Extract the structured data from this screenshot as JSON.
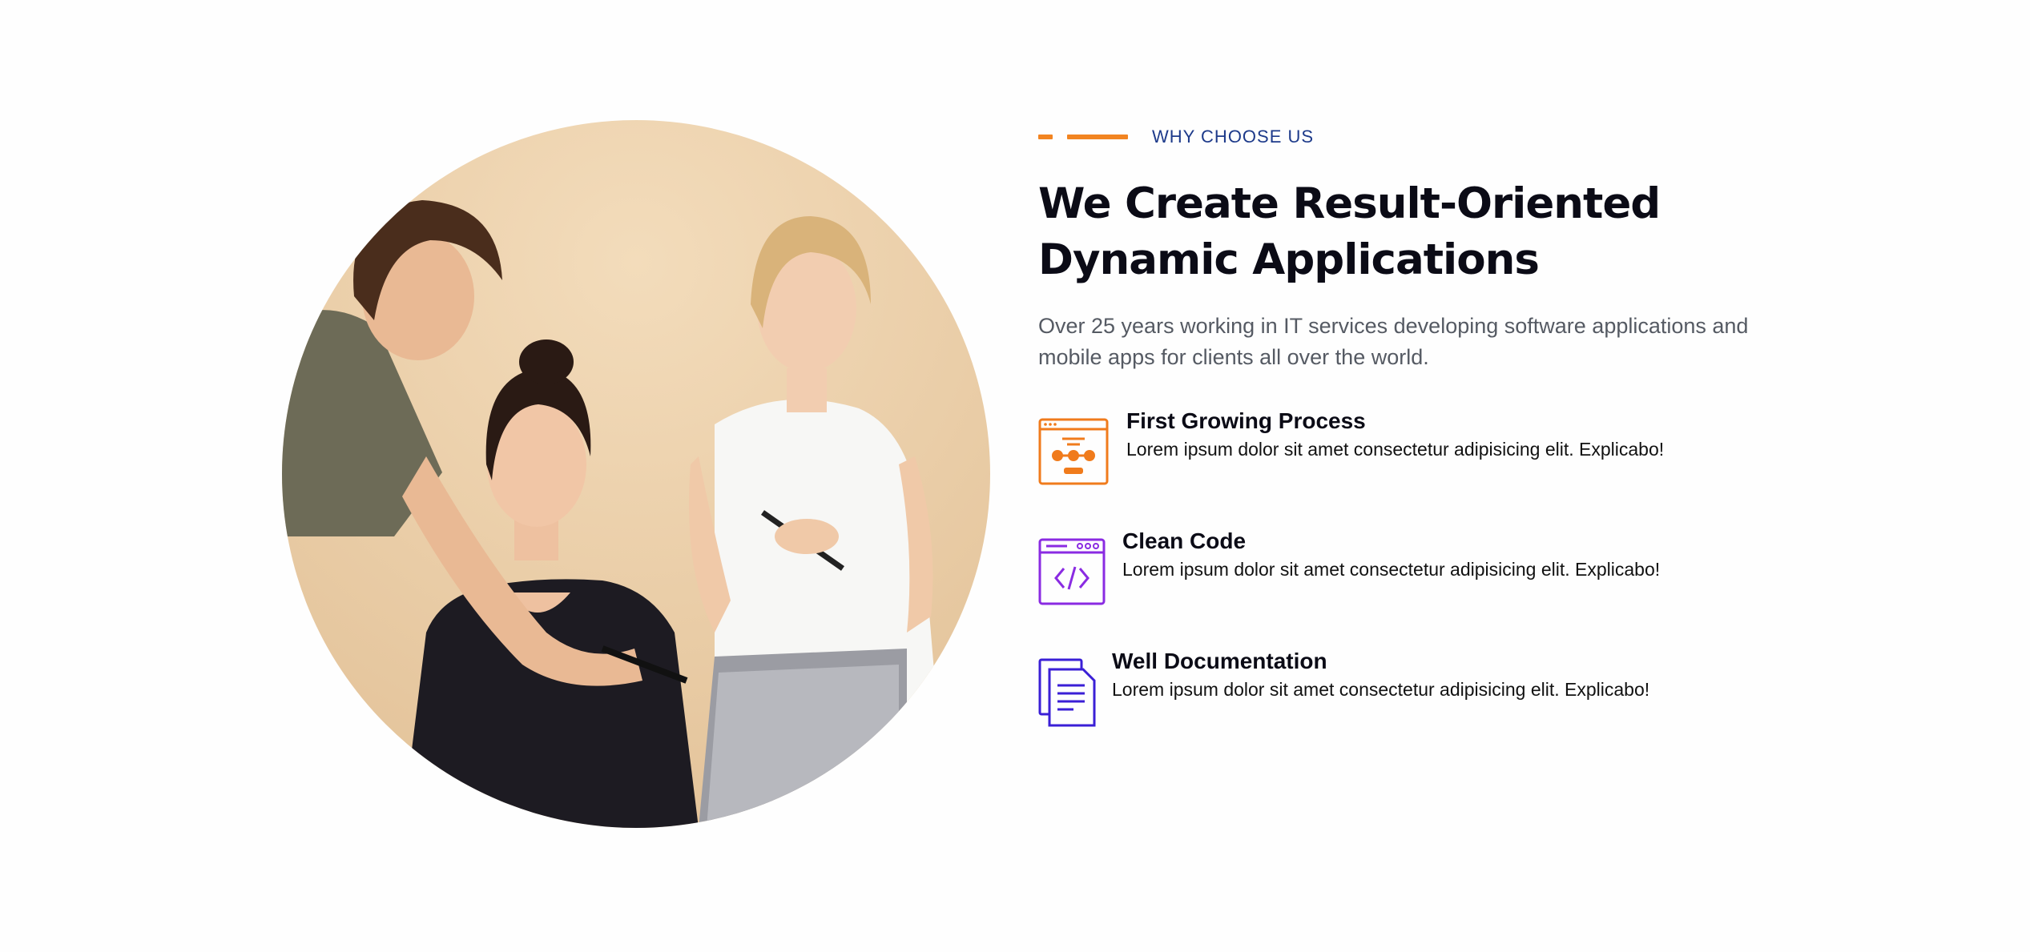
{
  "section": {
    "eyebrow": "WHY CHOOSE US",
    "title_line1": "We Create Result-Oriented",
    "title_line2": "Dynamic Applications",
    "description_line1": "Over 25 years working in IT services developing software applications and",
    "description_line2": "mobile apps for clients all over the world."
  },
  "features": [
    {
      "title": "First Growing Process",
      "description": "Lorem ipsum dolor sit amet consectetur adipisicing elit. Explicabo!",
      "icon": "process-steps-icon",
      "color": "#f07b1c"
    },
    {
      "title": "Clean Code",
      "description": "Lorem ipsum dolor sit amet consectetur adipisicing elit. Explicabo!",
      "icon": "code-window-icon",
      "color": "#8a2be2"
    },
    {
      "title": "Well Documentation",
      "description": "Lorem ipsum dolor sit amet consectetur adipisicing elit. Explicabo!",
      "icon": "documents-icon",
      "color": "#3a1fd6"
    }
  ],
  "colors": {
    "accent": "#f28421",
    "eyebrow": "#1d3a8a",
    "heading": "#0b0b16",
    "body": "#555a63",
    "photo_background": "#ecd2ad"
  }
}
